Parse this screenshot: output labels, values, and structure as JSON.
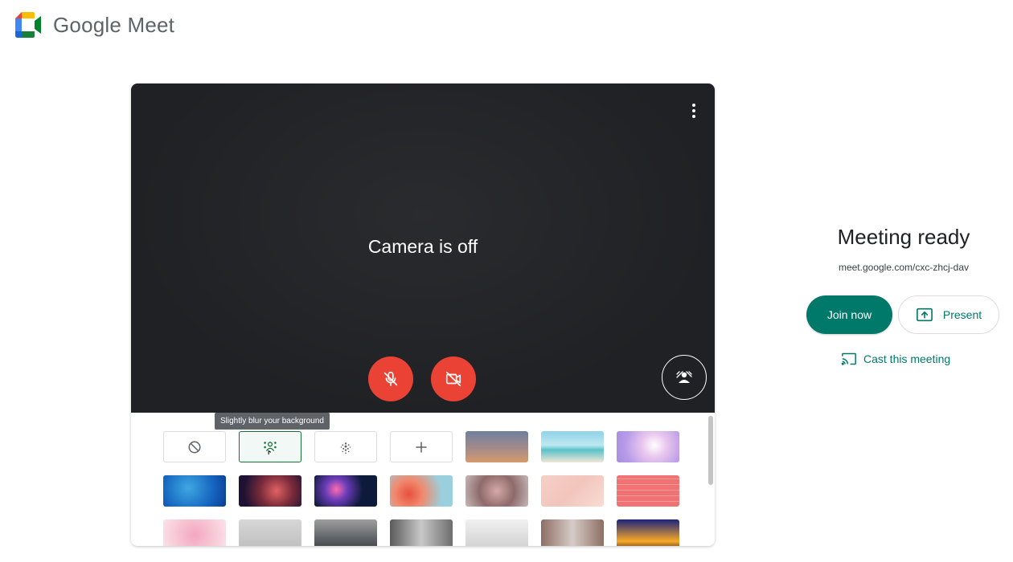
{
  "header": {
    "app_name": "Google Meet",
    "logo_icon": "google-meet-logo"
  },
  "preview": {
    "status_text": "Camera is off",
    "more_options_icon": "more-vert-icon",
    "mic_icon": "mic-off-icon",
    "camera_icon": "videocam-off-icon",
    "effects_icon": "background-effects-icon",
    "mic_color": "#ea4335",
    "camera_color": "#ea4335"
  },
  "effects": {
    "tooltip": "Slightly blur your background",
    "actions": [
      {
        "name": "no-effect",
        "icon": "block-icon"
      },
      {
        "name": "slight-blur",
        "icon": "blur-person-icon",
        "selected": true
      },
      {
        "name": "blur",
        "icon": "blur-icon"
      },
      {
        "name": "add-background",
        "icon": "plus-icon"
      }
    ],
    "backgrounds": [
      "sunset-sky",
      "beach",
      "pink-clouds",
      "blue-water",
      "galaxy",
      "fireworks",
      "flowers",
      "pebbles",
      "pink-sparkle",
      "pink-grid",
      "pink-petals",
      "white-office",
      "skylight",
      "interior-room",
      "loft",
      "bookshelf",
      "living-room",
      "night-house"
    ]
  },
  "join_panel": {
    "title": "Meeting ready",
    "meeting_url": "meet.google.com/cxc-zhcj-dav",
    "join_label": "Join now",
    "present_label": "Present",
    "present_icon": "present-to-all-icon",
    "cast_label": "Cast this meeting",
    "cast_icon": "cast-icon",
    "accent_color": "#00796b"
  }
}
